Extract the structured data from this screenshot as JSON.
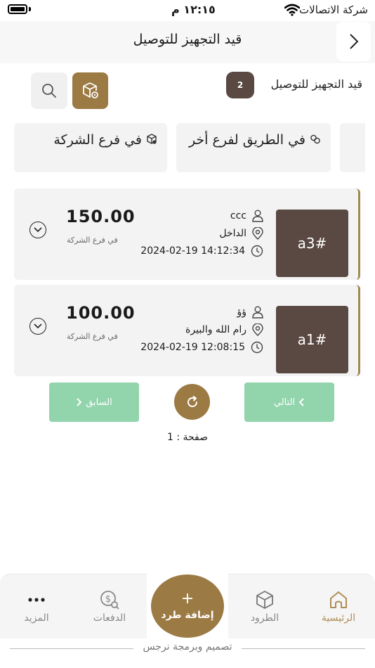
{
  "status_bar": {
    "time": "١٢:١٥ م",
    "carrier": "شركة الاتصالات"
  },
  "header": {
    "title": "قيد التجهيز للتوصيل",
    "back_icon": "chevron-right-icon"
  },
  "summary": {
    "label": "قيد التجهيز للتوصيل",
    "count": "2"
  },
  "tabs": [
    {
      "label": "في فرع الشركة",
      "icon": "package-icon"
    },
    {
      "label": "في الطريق لفرع أخر",
      "icon": "link-icon"
    }
  ],
  "orders": [
    {
      "id": "a3#",
      "name": "ccc",
      "location": "الداخل",
      "datetime": "2024-02-19 14:12:34",
      "amount": "150.00",
      "amount_status": "في فرع الشركة"
    },
    {
      "id": "a1#",
      "name": "ؤؤ",
      "location": "رام الله والبيرة",
      "datetime": "2024-02-19 12:08:15",
      "amount": "100.00",
      "amount_status": "في فرع الشركة"
    }
  ],
  "pager": {
    "next_label": "التالي",
    "prev_label": "السابق",
    "page_label": "صفحة : 1"
  },
  "bottom_nav": {
    "home": "الرئيسية",
    "parcels": "الطرود",
    "add": "إضافة طرد",
    "add_symbol": "+",
    "payments": "الدفعات",
    "more": "المزيد"
  },
  "footer": "تصميم وبرمجة نرجس",
  "colors": {
    "brown": "#5a4842",
    "gold": "#9c7a44",
    "green": "#92d4ac",
    "accent": "#b08d57"
  }
}
